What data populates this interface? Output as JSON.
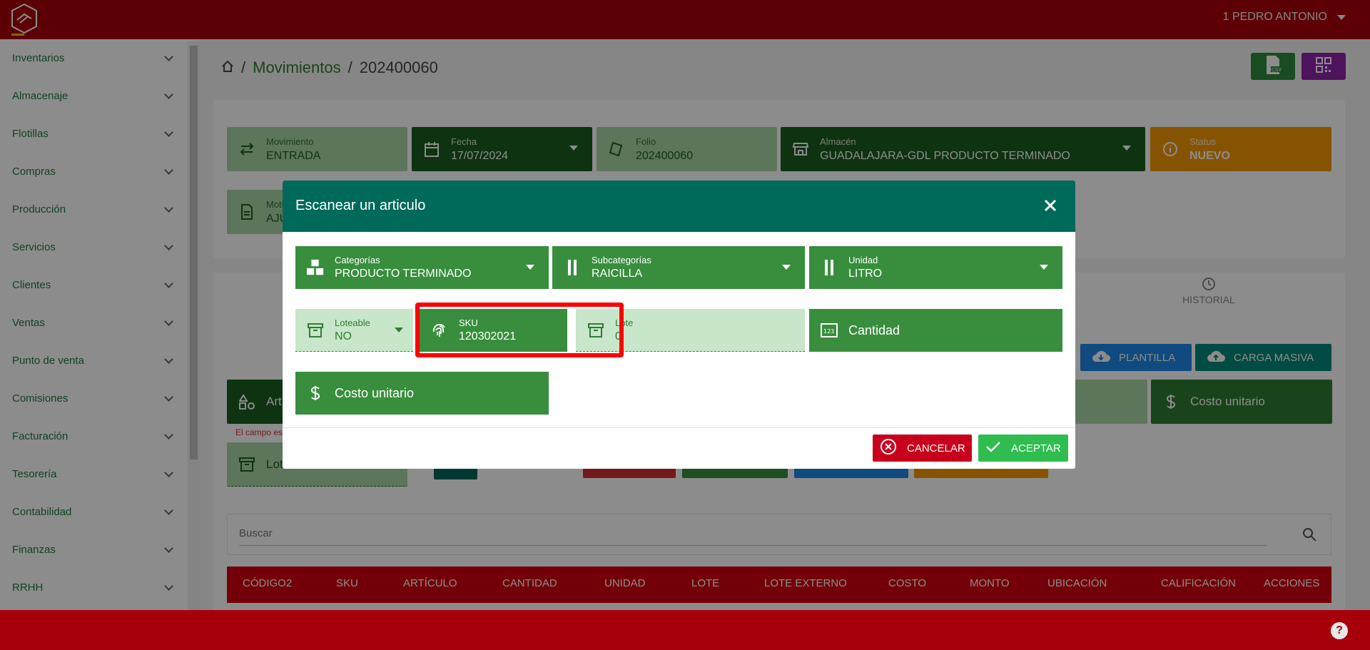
{
  "header": {
    "user": "1 PEDRO ANTONIO"
  },
  "sidebar": {
    "items": [
      "Inventarios",
      "Almacenaje",
      "Flotillas",
      "Compras",
      "Producción",
      "Servicios",
      "Clientes",
      "Ventas",
      "Punto de venta",
      "Comisiones",
      "Facturación",
      "Tesorería",
      "Contabilidad",
      "Finanzas",
      "RRHH"
    ]
  },
  "breadcrumb": {
    "section": "Movimientos",
    "current": "202400060"
  },
  "form": {
    "movimiento": {
      "label": "Movimiento",
      "value": "ENTRADA"
    },
    "fecha": {
      "label": "Fecha",
      "value": "17/07/2024"
    },
    "folio": {
      "label": "Folio",
      "value": "202400060"
    },
    "almacen": {
      "label": "Almacén",
      "value": "GUADALAJARA-GDL PRODUCTO TERMINADO"
    },
    "status": {
      "label": "Status",
      "value": "NUEVO"
    },
    "motivo": {
      "label": "Moti",
      "value": "AJU"
    }
  },
  "tabs": {
    "historial": "HISTORIAL"
  },
  "actions": {
    "plantilla": "PLANTILLA",
    "carga_masiva": "CARGA MASIVA"
  },
  "items_row": {
    "articulo_partial": "Artí",
    "costo_unitario": "Costo unitario",
    "lote_partial": "Lot",
    "error": "El campo es"
  },
  "search": {
    "placeholder": "Buscar"
  },
  "table": {
    "columns": [
      "CÓDIGO2",
      "SKU",
      "ARTÍCULO",
      "CANTIDAD",
      "UNIDAD",
      "LOTE",
      "LOTE EXTERNO",
      "COSTO",
      "MONTO",
      "UBICACIÓN",
      "CALIFICACIÓN",
      "ACCIONES"
    ]
  },
  "modal": {
    "title": "Escanear un articulo",
    "categorias": {
      "label": "Categorías",
      "value": "PRODUCTO TERMINADO"
    },
    "subcategorias": {
      "label": "Subcategorías",
      "value": "RAICILLA"
    },
    "unidad": {
      "label": "Unidad",
      "value": "LITRO"
    },
    "loteable": {
      "label": "Loteable",
      "value": "NO"
    },
    "sku": {
      "label": "SKU",
      "value": "120302021"
    },
    "lote": {
      "label": "Lote",
      "value": "0"
    },
    "cantidad": {
      "label": "Cantidad"
    },
    "costo_unitario": {
      "label": "Costo unitario"
    },
    "cancel": "CANCELAR",
    "accept": "ACEPTAR"
  },
  "colors": {
    "brand_red": "#a8000a",
    "modal_header": "#006a5a",
    "green": "#388e3c",
    "orange": "#f59a00"
  }
}
